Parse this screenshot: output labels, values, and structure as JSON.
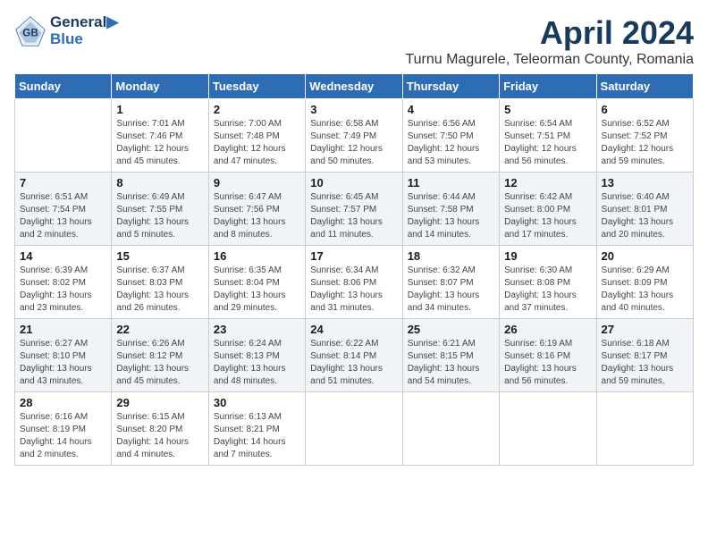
{
  "header": {
    "logo_line1": "General",
    "logo_line2": "Blue",
    "month_title": "April 2024",
    "location": "Turnu Magurele, Teleorman County, Romania"
  },
  "weekdays": [
    "Sunday",
    "Monday",
    "Tuesday",
    "Wednesday",
    "Thursday",
    "Friday",
    "Saturday"
  ],
  "weeks": [
    [
      {
        "day": "",
        "info": ""
      },
      {
        "day": "1",
        "info": "Sunrise: 7:01 AM\nSunset: 7:46 PM\nDaylight: 12 hours\nand 45 minutes."
      },
      {
        "day": "2",
        "info": "Sunrise: 7:00 AM\nSunset: 7:48 PM\nDaylight: 12 hours\nand 47 minutes."
      },
      {
        "day": "3",
        "info": "Sunrise: 6:58 AM\nSunset: 7:49 PM\nDaylight: 12 hours\nand 50 minutes."
      },
      {
        "day": "4",
        "info": "Sunrise: 6:56 AM\nSunset: 7:50 PM\nDaylight: 12 hours\nand 53 minutes."
      },
      {
        "day": "5",
        "info": "Sunrise: 6:54 AM\nSunset: 7:51 PM\nDaylight: 12 hours\nand 56 minutes."
      },
      {
        "day": "6",
        "info": "Sunrise: 6:52 AM\nSunset: 7:52 PM\nDaylight: 12 hours\nand 59 minutes."
      }
    ],
    [
      {
        "day": "7",
        "info": "Sunrise: 6:51 AM\nSunset: 7:54 PM\nDaylight: 13 hours\nand 2 minutes."
      },
      {
        "day": "8",
        "info": "Sunrise: 6:49 AM\nSunset: 7:55 PM\nDaylight: 13 hours\nand 5 minutes."
      },
      {
        "day": "9",
        "info": "Sunrise: 6:47 AM\nSunset: 7:56 PM\nDaylight: 13 hours\nand 8 minutes."
      },
      {
        "day": "10",
        "info": "Sunrise: 6:45 AM\nSunset: 7:57 PM\nDaylight: 13 hours\nand 11 minutes."
      },
      {
        "day": "11",
        "info": "Sunrise: 6:44 AM\nSunset: 7:58 PM\nDaylight: 13 hours\nand 14 minutes."
      },
      {
        "day": "12",
        "info": "Sunrise: 6:42 AM\nSunset: 8:00 PM\nDaylight: 13 hours\nand 17 minutes."
      },
      {
        "day": "13",
        "info": "Sunrise: 6:40 AM\nSunset: 8:01 PM\nDaylight: 13 hours\nand 20 minutes."
      }
    ],
    [
      {
        "day": "14",
        "info": "Sunrise: 6:39 AM\nSunset: 8:02 PM\nDaylight: 13 hours\nand 23 minutes."
      },
      {
        "day": "15",
        "info": "Sunrise: 6:37 AM\nSunset: 8:03 PM\nDaylight: 13 hours\nand 26 minutes."
      },
      {
        "day": "16",
        "info": "Sunrise: 6:35 AM\nSunset: 8:04 PM\nDaylight: 13 hours\nand 29 minutes."
      },
      {
        "day": "17",
        "info": "Sunrise: 6:34 AM\nSunset: 8:06 PM\nDaylight: 13 hours\nand 31 minutes."
      },
      {
        "day": "18",
        "info": "Sunrise: 6:32 AM\nSunset: 8:07 PM\nDaylight: 13 hours\nand 34 minutes."
      },
      {
        "day": "19",
        "info": "Sunrise: 6:30 AM\nSunset: 8:08 PM\nDaylight: 13 hours\nand 37 minutes."
      },
      {
        "day": "20",
        "info": "Sunrise: 6:29 AM\nSunset: 8:09 PM\nDaylight: 13 hours\nand 40 minutes."
      }
    ],
    [
      {
        "day": "21",
        "info": "Sunrise: 6:27 AM\nSunset: 8:10 PM\nDaylight: 13 hours\nand 43 minutes."
      },
      {
        "day": "22",
        "info": "Sunrise: 6:26 AM\nSunset: 8:12 PM\nDaylight: 13 hours\nand 45 minutes."
      },
      {
        "day": "23",
        "info": "Sunrise: 6:24 AM\nSunset: 8:13 PM\nDaylight: 13 hours\nand 48 minutes."
      },
      {
        "day": "24",
        "info": "Sunrise: 6:22 AM\nSunset: 8:14 PM\nDaylight: 13 hours\nand 51 minutes."
      },
      {
        "day": "25",
        "info": "Sunrise: 6:21 AM\nSunset: 8:15 PM\nDaylight: 13 hours\nand 54 minutes."
      },
      {
        "day": "26",
        "info": "Sunrise: 6:19 AM\nSunset: 8:16 PM\nDaylight: 13 hours\nand 56 minutes."
      },
      {
        "day": "27",
        "info": "Sunrise: 6:18 AM\nSunset: 8:17 PM\nDaylight: 13 hours\nand 59 minutes."
      }
    ],
    [
      {
        "day": "28",
        "info": "Sunrise: 6:16 AM\nSunset: 8:19 PM\nDaylight: 14 hours\nand 2 minutes."
      },
      {
        "day": "29",
        "info": "Sunrise: 6:15 AM\nSunset: 8:20 PM\nDaylight: 14 hours\nand 4 minutes."
      },
      {
        "day": "30",
        "info": "Sunrise: 6:13 AM\nSunset: 8:21 PM\nDaylight: 14 hours\nand 7 minutes."
      },
      {
        "day": "",
        "info": ""
      },
      {
        "day": "",
        "info": ""
      },
      {
        "day": "",
        "info": ""
      },
      {
        "day": "",
        "info": ""
      }
    ]
  ]
}
